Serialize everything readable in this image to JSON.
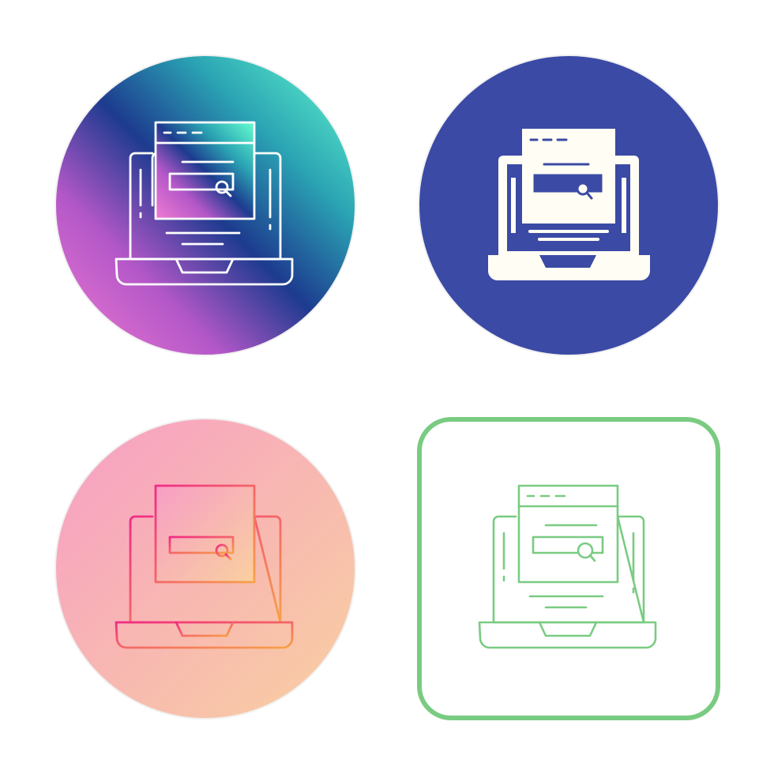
{
  "icon_set": {
    "subject": "laptop-search-icon",
    "variants": [
      {
        "style": "line-on-gradient-circle",
        "background": [
          "#c05cd0",
          "#1d3e92",
          "#5cf5cf"
        ],
        "stroke": "#ffffff"
      },
      {
        "style": "glyph-on-solid-circle",
        "background": "#3b4aa5",
        "fill": "#fffdf4"
      },
      {
        "style": "gradient-line-on-pastel-circle",
        "background": [
          "#f8a6c4",
          "#f9cba3"
        ],
        "stroke": [
          "#f2317f",
          "#f7a04b"
        ]
      },
      {
        "style": "line-in-rounded-square",
        "frame": "#7acb82",
        "stroke": "#7acb82",
        "background": "#ffffff"
      }
    ]
  }
}
